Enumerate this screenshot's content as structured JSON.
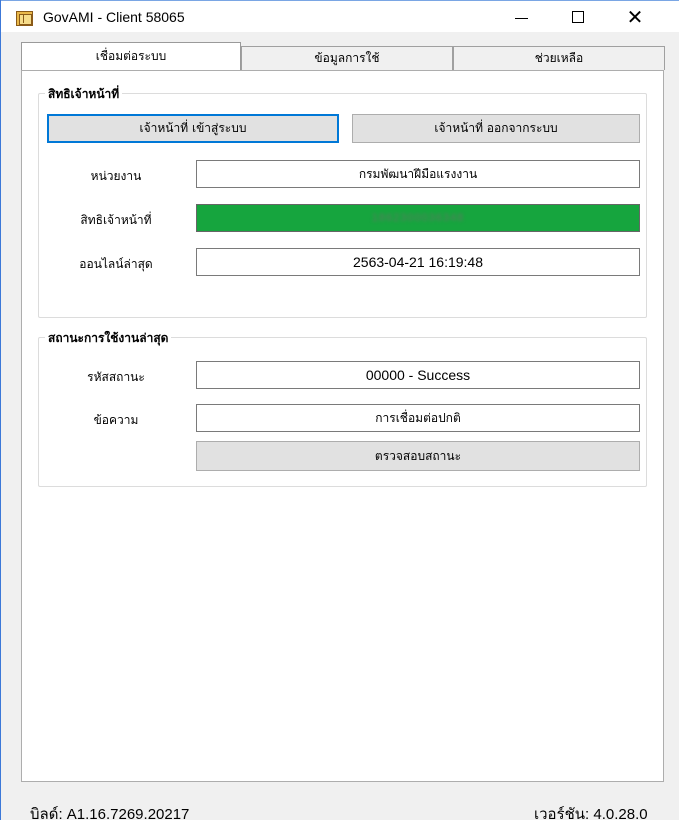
{
  "window": {
    "title": "GovAMI - Client 58065"
  },
  "tabs": [
    {
      "label": "เชื่อมต่อระบบ"
    },
    {
      "label": "ข้อมูลการใช้"
    },
    {
      "label": "ช่วยเหลือ"
    }
  ],
  "officer_group": {
    "title": "สิทธิเจ้าหน้าที่",
    "login_button": "เจ้าหน้าที่ เข้าสู่ระบบ",
    "logout_button": "เจ้าหน้าที่ ออกจากระบบ",
    "agency_label": "หน่วยงาน",
    "agency_value": "กรมพัฒนาฝีมือแรงงาน",
    "officer_id_label": "สิทธิเจ้าหน้าที่",
    "officer_id_value": "1862300036348",
    "last_online_label": "ออนไลน์ล่าสุด",
    "last_online_value": "2563-04-21 16:19:48"
  },
  "status_group": {
    "title": "สถานะการใช้งานล่าสุด",
    "code_label": "รหัสสถานะ",
    "code_value": "00000 - Success",
    "message_label": "ข้อความ",
    "message_value": "การเชื่อมต่อปกติ",
    "check_button": "ตรวจสอบสถานะ"
  },
  "footer": {
    "build": "บิลด์: A1.16.7269.20217",
    "version": "เวอร์ชัน: 4.0.28.0"
  },
  "colors": {
    "officer_field_bg": "#16a53e",
    "focus_border": "#0078d7"
  },
  "icons": {
    "app": "app-icon",
    "minimize": "minimize-icon",
    "maximize": "maximize-icon",
    "close": "close-icon"
  }
}
